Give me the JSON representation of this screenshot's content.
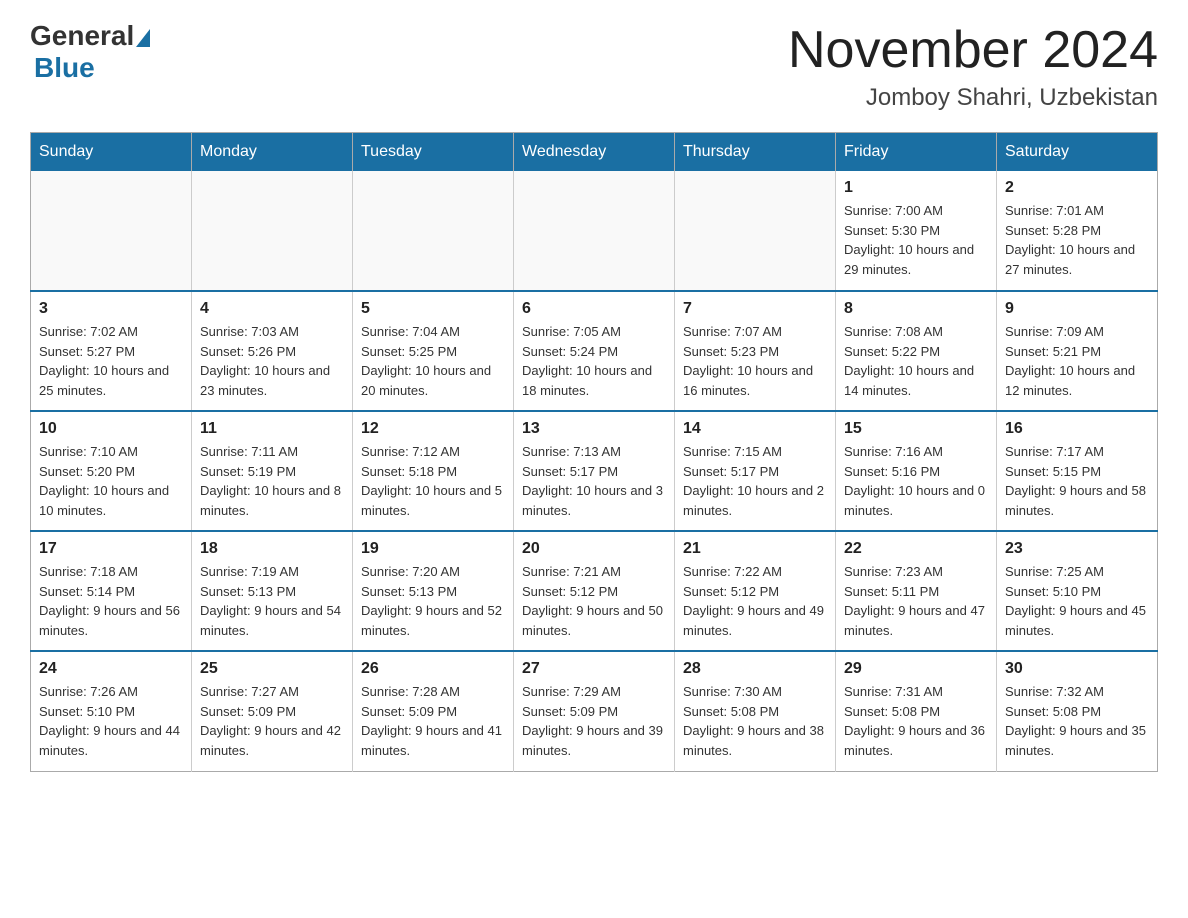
{
  "header": {
    "logo_general": "General",
    "logo_blue": "Blue",
    "month_title": "November 2024",
    "location": "Jomboy Shahri, Uzbekistan"
  },
  "weekdays": [
    "Sunday",
    "Monday",
    "Tuesday",
    "Wednesday",
    "Thursday",
    "Friday",
    "Saturday"
  ],
  "weeks": [
    [
      {
        "day": "",
        "info": ""
      },
      {
        "day": "",
        "info": ""
      },
      {
        "day": "",
        "info": ""
      },
      {
        "day": "",
        "info": ""
      },
      {
        "day": "",
        "info": ""
      },
      {
        "day": "1",
        "info": "Sunrise: 7:00 AM\nSunset: 5:30 PM\nDaylight: 10 hours and 29 minutes."
      },
      {
        "day": "2",
        "info": "Sunrise: 7:01 AM\nSunset: 5:28 PM\nDaylight: 10 hours and 27 minutes."
      }
    ],
    [
      {
        "day": "3",
        "info": "Sunrise: 7:02 AM\nSunset: 5:27 PM\nDaylight: 10 hours and 25 minutes."
      },
      {
        "day": "4",
        "info": "Sunrise: 7:03 AM\nSunset: 5:26 PM\nDaylight: 10 hours and 23 minutes."
      },
      {
        "day": "5",
        "info": "Sunrise: 7:04 AM\nSunset: 5:25 PM\nDaylight: 10 hours and 20 minutes."
      },
      {
        "day": "6",
        "info": "Sunrise: 7:05 AM\nSunset: 5:24 PM\nDaylight: 10 hours and 18 minutes."
      },
      {
        "day": "7",
        "info": "Sunrise: 7:07 AM\nSunset: 5:23 PM\nDaylight: 10 hours and 16 minutes."
      },
      {
        "day": "8",
        "info": "Sunrise: 7:08 AM\nSunset: 5:22 PM\nDaylight: 10 hours and 14 minutes."
      },
      {
        "day": "9",
        "info": "Sunrise: 7:09 AM\nSunset: 5:21 PM\nDaylight: 10 hours and 12 minutes."
      }
    ],
    [
      {
        "day": "10",
        "info": "Sunrise: 7:10 AM\nSunset: 5:20 PM\nDaylight: 10 hours and 10 minutes."
      },
      {
        "day": "11",
        "info": "Sunrise: 7:11 AM\nSunset: 5:19 PM\nDaylight: 10 hours and 8 minutes."
      },
      {
        "day": "12",
        "info": "Sunrise: 7:12 AM\nSunset: 5:18 PM\nDaylight: 10 hours and 5 minutes."
      },
      {
        "day": "13",
        "info": "Sunrise: 7:13 AM\nSunset: 5:17 PM\nDaylight: 10 hours and 3 minutes."
      },
      {
        "day": "14",
        "info": "Sunrise: 7:15 AM\nSunset: 5:17 PM\nDaylight: 10 hours and 2 minutes."
      },
      {
        "day": "15",
        "info": "Sunrise: 7:16 AM\nSunset: 5:16 PM\nDaylight: 10 hours and 0 minutes."
      },
      {
        "day": "16",
        "info": "Sunrise: 7:17 AM\nSunset: 5:15 PM\nDaylight: 9 hours and 58 minutes."
      }
    ],
    [
      {
        "day": "17",
        "info": "Sunrise: 7:18 AM\nSunset: 5:14 PM\nDaylight: 9 hours and 56 minutes."
      },
      {
        "day": "18",
        "info": "Sunrise: 7:19 AM\nSunset: 5:13 PM\nDaylight: 9 hours and 54 minutes."
      },
      {
        "day": "19",
        "info": "Sunrise: 7:20 AM\nSunset: 5:13 PM\nDaylight: 9 hours and 52 minutes."
      },
      {
        "day": "20",
        "info": "Sunrise: 7:21 AM\nSunset: 5:12 PM\nDaylight: 9 hours and 50 minutes."
      },
      {
        "day": "21",
        "info": "Sunrise: 7:22 AM\nSunset: 5:12 PM\nDaylight: 9 hours and 49 minutes."
      },
      {
        "day": "22",
        "info": "Sunrise: 7:23 AM\nSunset: 5:11 PM\nDaylight: 9 hours and 47 minutes."
      },
      {
        "day": "23",
        "info": "Sunrise: 7:25 AM\nSunset: 5:10 PM\nDaylight: 9 hours and 45 minutes."
      }
    ],
    [
      {
        "day": "24",
        "info": "Sunrise: 7:26 AM\nSunset: 5:10 PM\nDaylight: 9 hours and 44 minutes."
      },
      {
        "day": "25",
        "info": "Sunrise: 7:27 AM\nSunset: 5:09 PM\nDaylight: 9 hours and 42 minutes."
      },
      {
        "day": "26",
        "info": "Sunrise: 7:28 AM\nSunset: 5:09 PM\nDaylight: 9 hours and 41 minutes."
      },
      {
        "day": "27",
        "info": "Sunrise: 7:29 AM\nSunset: 5:09 PM\nDaylight: 9 hours and 39 minutes."
      },
      {
        "day": "28",
        "info": "Sunrise: 7:30 AM\nSunset: 5:08 PM\nDaylight: 9 hours and 38 minutes."
      },
      {
        "day": "29",
        "info": "Sunrise: 7:31 AM\nSunset: 5:08 PM\nDaylight: 9 hours and 36 minutes."
      },
      {
        "day": "30",
        "info": "Sunrise: 7:32 AM\nSunset: 5:08 PM\nDaylight: 9 hours and 35 minutes."
      }
    ]
  ]
}
